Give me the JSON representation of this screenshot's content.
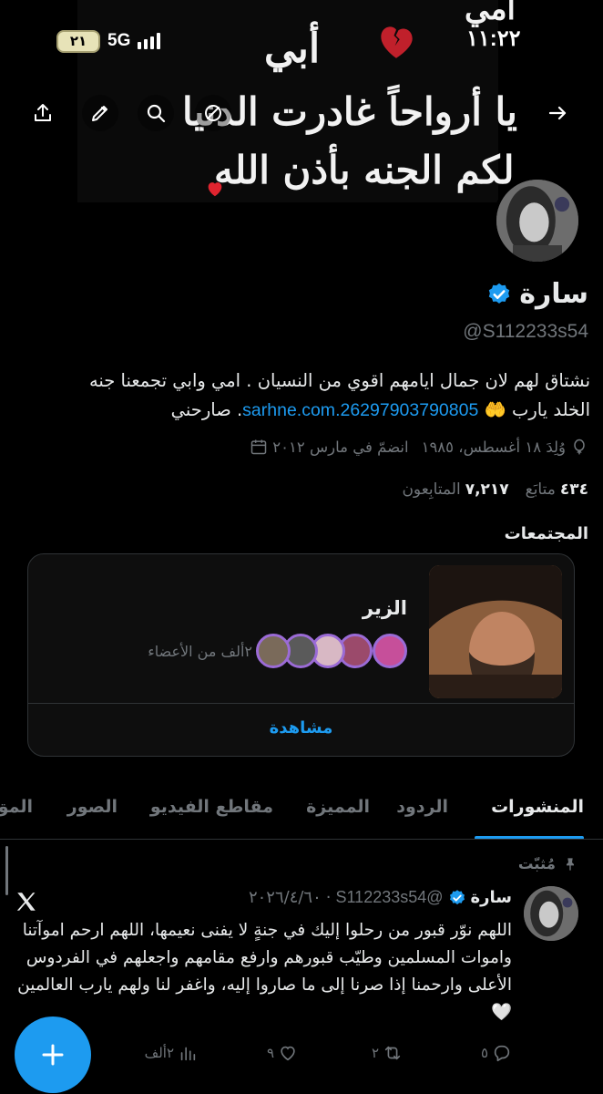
{
  "status_bar": {
    "time": "١١:٢٢",
    "battery": "٢١",
    "network": "5G"
  },
  "banner": {
    "line_mom": "أمي",
    "line_dad": "أبي",
    "line_1": "يا أرواحاً غادرت الدنيا",
    "line_2": "لكم الجنه بأذن الله"
  },
  "header_icons": [
    "share-icon",
    "edit-icon",
    "search-icon",
    "mute-icon",
    "forward-arrow-icon"
  ],
  "profile": {
    "name": "سارة",
    "handle": "@S112233s54",
    "bio_line1": "نشتاق لهم لان جمال ايامهم اقوي من النسيان . امي وابي تجمعنا جنه",
    "bio_line2_prefix": "الخلد يارب 🤲",
    "bio_link": "26297903790805.sarhne.com",
    "bio_suffix": ". صارحني",
    "born": "وُلِدَ ١٨ أغسطس، ١٩٨٥",
    "joined": "انضمّ في مارس ٢٠١٢",
    "following_count": "٤٣٤",
    "following_label": "متابَع",
    "followers_count": "٧,٢١٧",
    "followers_label": "المتابِعون"
  },
  "communities": {
    "title": "المجتمعات",
    "card": {
      "name": "الزير",
      "members": "٢ألف من الأعضاء",
      "view_label": "مشاهدة"
    }
  },
  "tabs": [
    {
      "label": "المنشورات",
      "active": true
    },
    {
      "label": "الردود",
      "active": false
    },
    {
      "label": "المميزة",
      "active": false
    },
    {
      "label": "مقاطع الفيديو",
      "active": false
    },
    {
      "label": "الصور",
      "active": false
    },
    {
      "label": "المق",
      "active": false
    }
  ],
  "pinned_post": {
    "pinned_label": "مُثبّت",
    "author": "سارة",
    "handle": "@S112233s54",
    "date": "٢٠٢٦/٤/٦٠",
    "text": "اللهم نوّر قبور من رحلوا إليك في جنةٍ لا يفنى نعيمها، اللهم ارحم اموآتنا واموات المسلمين وطيّب قبورهم وارفع مقامهم واجعلهم في الفردوس الأعلى وارحمنا إذا صرنا إلى ما صاروا إليه، واغفر لنا ولهم يارب العالمين 🤍",
    "replies": "٥",
    "reposts": "٢",
    "likes": "٩",
    "views": "٢ألف"
  },
  "colors": {
    "accent": "#1d9bf0",
    "background": "#000000",
    "muted": "#71767b",
    "border": "#2f3336"
  }
}
